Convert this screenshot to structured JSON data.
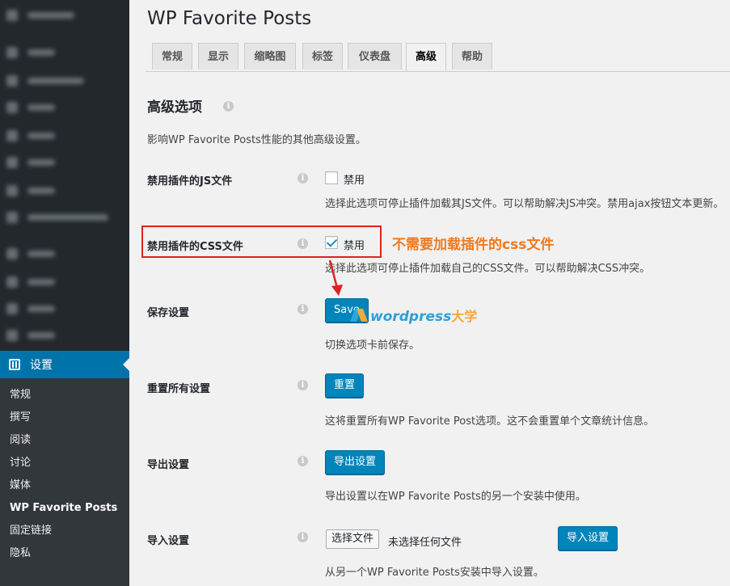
{
  "page": {
    "title": "WP Favorite Posts"
  },
  "tabs": [
    {
      "label": "常规"
    },
    {
      "label": "显示"
    },
    {
      "label": "缩略图"
    },
    {
      "label": "标签"
    },
    {
      "label": "仪表盘"
    },
    {
      "label": "高级",
      "active": true
    },
    {
      "label": "帮助"
    }
  ],
  "sidebar": {
    "settings_label": "设置",
    "submenu": [
      {
        "label": "常规"
      },
      {
        "label": "撰写"
      },
      {
        "label": "阅读"
      },
      {
        "label": "讨论"
      },
      {
        "label": "媒体"
      },
      {
        "label": "WP Favorite Posts",
        "current": true
      },
      {
        "label": "固定链接"
      },
      {
        "label": "隐私"
      }
    ]
  },
  "section": {
    "title": "高级选项",
    "description": "影响WP Favorite Posts性能的其他高级设置。"
  },
  "settings": {
    "disable_js": {
      "label": "禁用插件的JS文件",
      "checkbox_label": "禁用",
      "checked": false,
      "description": "选择此选项可停止插件加载其JS文件。可以帮助解决JS冲突。禁用ajax按钮文本更新。"
    },
    "disable_css": {
      "label": "禁用插件的CSS文件",
      "checkbox_label": "禁用",
      "checked": true,
      "description": "选择此选项可停止插件加载自己的CSS文件。可以帮助解决CSS冲突。"
    },
    "save": {
      "label": "保存设置",
      "button": "Save",
      "description": "切换选项卡前保存。"
    },
    "reset": {
      "label": "重置所有设置",
      "button": "重置",
      "description": "这将重置所有WP Favorite Post选项。这不会重置单个文章统计信息。"
    },
    "export": {
      "label": "导出设置",
      "button": "导出设置",
      "description": "导出设置以在WP Favorite Posts的另一个安装中使用。"
    },
    "import": {
      "label": "导入设置",
      "file_button": "选择文件",
      "file_status": "未选择任何文件",
      "button": "导入设置",
      "description": "从另一个WP Favorite Posts安装中导入设置。"
    }
  },
  "annotation": {
    "callout": "不需要加载插件的css文件"
  },
  "watermark": {
    "text": "wordpress",
    "text_cn": "大学"
  },
  "colors": {
    "accent": "#0073aa",
    "button": "#0085ba",
    "annotation_border": "#e02222",
    "annotation_text": "#f07a1e"
  }
}
